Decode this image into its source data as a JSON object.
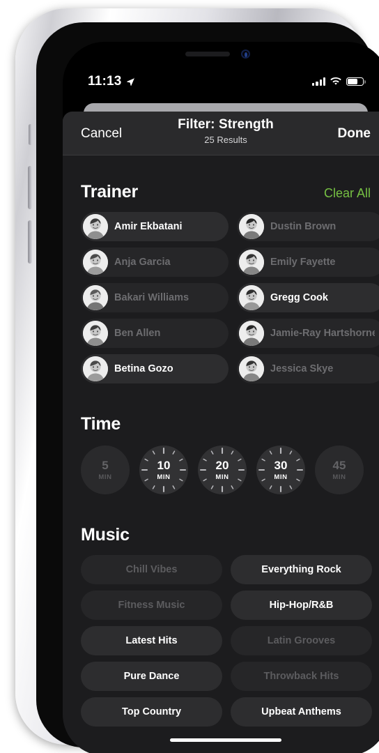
{
  "status_bar": {
    "time": "11:13",
    "location_icon": "location-arrow-icon",
    "signal_icon": "cellular-signal-icon",
    "signal_bars": 4,
    "wifi_icon": "wifi-icon",
    "battery_icon": "battery-icon",
    "battery_percent": 72
  },
  "sheet": {
    "cancel_label": "Cancel",
    "done_label": "Done",
    "title": "Filter: Strength",
    "results_label": "25 Results"
  },
  "trainer_section": {
    "title": "Trainer",
    "clear_all_label": "Clear All",
    "clear_all_color": "#76c043",
    "items": [
      {
        "name": "Amir Ekbatani",
        "selected": true
      },
      {
        "name": "Dustin Brown",
        "selected": false
      },
      {
        "name": "Anja Garcia",
        "selected": false
      },
      {
        "name": "Emily Fayette",
        "selected": false
      },
      {
        "name": "Bakari Williams",
        "selected": false
      },
      {
        "name": "Gregg Cook",
        "selected": true
      },
      {
        "name": "Ben Allen",
        "selected": false
      },
      {
        "name": "Jamie-Ray Hartshorne",
        "selected": false
      },
      {
        "name": "Betina Gozo",
        "selected": true
      },
      {
        "name": "Jessica Skye",
        "selected": false
      }
    ],
    "clipped_column_count": 5
  },
  "time_section": {
    "title": "Time",
    "unit_label": "MIN",
    "options": [
      {
        "value": "5",
        "enabled": false
      },
      {
        "value": "10",
        "enabled": true
      },
      {
        "value": "20",
        "enabled": true
      },
      {
        "value": "30",
        "enabled": true
      },
      {
        "value": "45",
        "enabled": false
      }
    ]
  },
  "music_section": {
    "title": "Music",
    "items": [
      {
        "name": "Chill Vibes",
        "selected": false
      },
      {
        "name": "Everything Rock",
        "selected": true
      },
      {
        "name": "Fitness Music",
        "selected": false
      },
      {
        "name": "Hip-Hop/R&B",
        "selected": true
      },
      {
        "name": "Latest Hits",
        "selected": true
      },
      {
        "name": "Latin Grooves",
        "selected": false
      },
      {
        "name": "Pure Dance",
        "selected": true
      },
      {
        "name": "Throwback Hits",
        "selected": false
      },
      {
        "name": "Top Country",
        "selected": true
      },
      {
        "name": "Upbeat Anthems",
        "selected": true
      }
    ]
  },
  "home_indicator": "home-indicator"
}
